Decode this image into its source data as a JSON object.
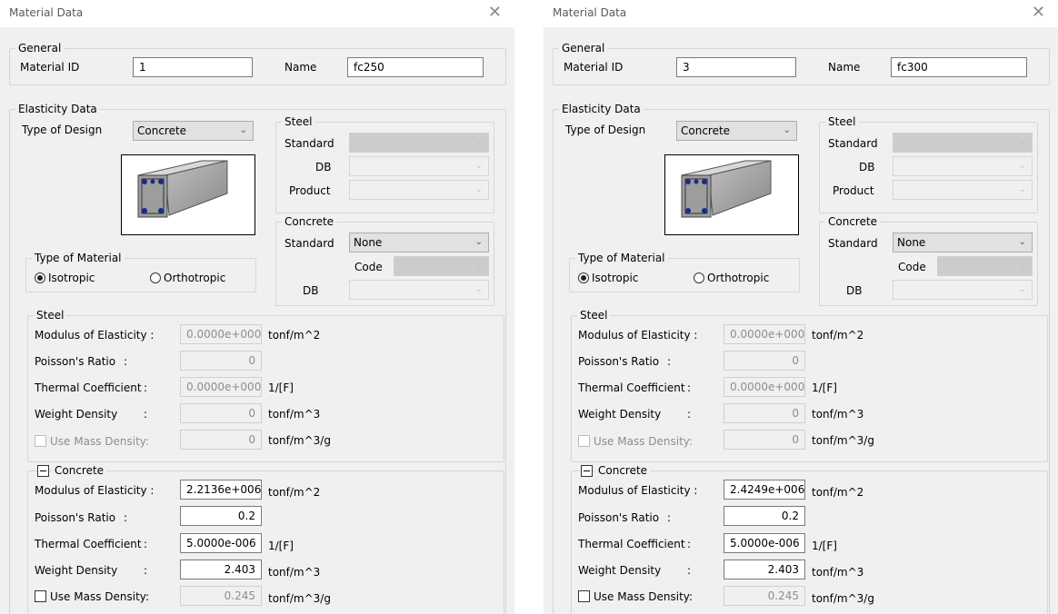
{
  "common": {
    "window_title": "Material Data",
    "close_glyph": "✕",
    "general_title": "General",
    "material_id_label": "Material ID",
    "name_label": "Name",
    "elasticity_title": "Elasticity Data",
    "type_of_design_label": "Type of Design",
    "type_of_design_value": "Concrete",
    "steel_group_title": "Steel",
    "standard_label": "Standard",
    "db_label": "DB",
    "product_label": "Product",
    "concrete_group_title": "Concrete",
    "concrete_standard_value": "None",
    "code_label": "Code",
    "type_of_material_title": "Type of Material",
    "isotropic_label": "Isotropic",
    "orthotropic_label": "Orthotropic",
    "steel_props_title": "Steel",
    "concrete_props_title": "Concrete",
    "modulus_label": "Modulus of Elasticity :",
    "poisson_label": "Poisson's Ratio",
    "thermal_label": "Thermal Coefficient",
    "weight_label": "Weight Density",
    "colon": ":",
    "use_mass_label": "Use Mass Density:",
    "unit_modulus": "tonf/m^2",
    "unit_thermal": "1/[F]",
    "unit_weight": "tonf/m^3",
    "unit_mass": "tonf/m^3/g",
    "steel_modulus": "0.0000e+000",
    "steel_poisson": "0",
    "steel_thermal": "0.0000e+000",
    "steel_weight": "0",
    "steel_mass": "0",
    "icons": {
      "close": "close-icon",
      "dropdown": "chevron-down-icon",
      "collapse": "collapse-minus-icon",
      "section": "rc-column-section-image"
    },
    "colors": {
      "dialog_bg": "#f0f0f0",
      "disabled_text": "#8d8d8d",
      "rebar": "#1b2a8c"
    }
  },
  "dialogs": [
    {
      "material_id": "1",
      "name": "fc250",
      "conc_modulus": "2.2136e+006",
      "conc_poisson": "0.2",
      "conc_thermal": "5.0000e-006",
      "conc_weight": "2.403",
      "conc_mass": "0.245"
    },
    {
      "material_id": "3",
      "name": "fc300",
      "conc_modulus": "2.4249e+006",
      "conc_poisson": "0.2",
      "conc_thermal": "5.0000e-006",
      "conc_weight": "2.403",
      "conc_mass": "0.245"
    }
  ]
}
